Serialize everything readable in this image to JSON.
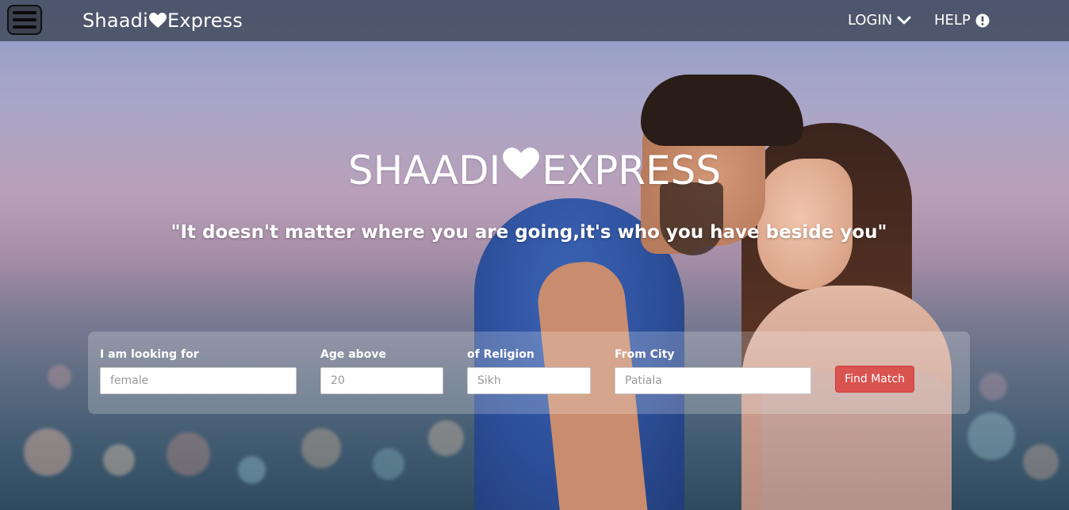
{
  "navbar": {
    "brand_left": "Shaadi",
    "brand_right": "Express",
    "login_label": "LOGIN",
    "help_label": "HELP"
  },
  "hero": {
    "title_left": "SHAADI",
    "title_right": "EXPRESS",
    "quote": "\"It doesn't matter where you are going,it's who you have beside you\""
  },
  "search": {
    "looking_for": {
      "label": "I am looking for",
      "placeholder": "female"
    },
    "age": {
      "label": "Age above",
      "placeholder": "20"
    },
    "religion": {
      "label": "of Religion",
      "placeholder": "Sikh"
    },
    "city": {
      "label": "From City",
      "placeholder": "Patiala"
    },
    "find_button": "Find Match"
  },
  "colors": {
    "navbar_bg": "#485064",
    "button_bg": "#d9534f",
    "text": "#ffffff"
  },
  "icons": [
    "menu-icon",
    "heart-icon",
    "chevron-down-icon",
    "exclamation-circle-icon"
  ]
}
